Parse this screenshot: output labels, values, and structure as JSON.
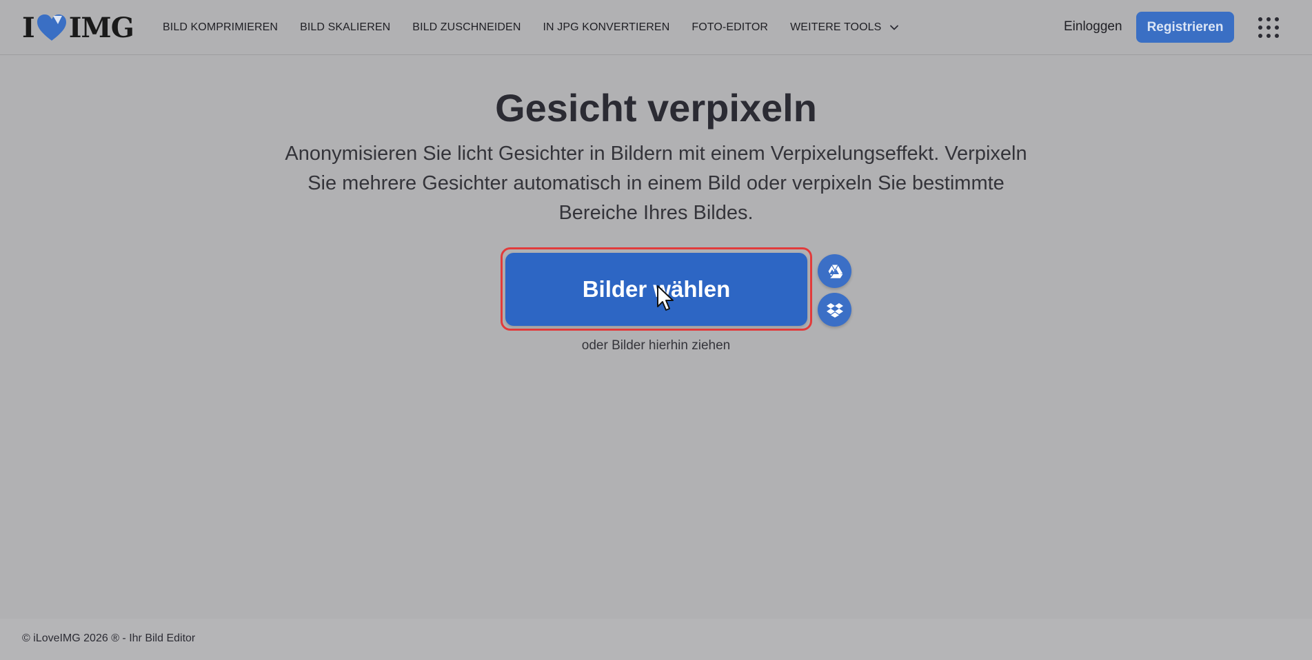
{
  "header": {
    "logo": {
      "left": "I",
      "right": "IMG",
      "heart_color": "#3a6fc4"
    },
    "nav": [
      {
        "label": "BILD KOMPRIMIEREN"
      },
      {
        "label": "BILD SKALIEREN"
      },
      {
        "label": "BILD ZUSCHNEIDEN"
      },
      {
        "label": "IN JPG KONVERTIEREN"
      },
      {
        "label": "FOTO-EDITOR"
      },
      {
        "label": "WEITERE TOOLS",
        "icon": "chevron-down-icon"
      }
    ],
    "login_label": "Einloggen",
    "register_label": "Registrieren",
    "apps_icon": "grid-menu-icon"
  },
  "main": {
    "title": "Gesicht verpixeln",
    "subtitle": "Anonymisieren Sie licht Gesichter in Bildern mit einem Verpixelungseffekt. Verpixeln Sie mehrere Gesichter automatisch in einem Bild oder verpixeln Sie bestimmte Bereiche Ihres Bildes.",
    "select_button_label": "Bilder wählen",
    "cloud_buttons": [
      {
        "icon": "google-drive-icon"
      },
      {
        "icon": "dropbox-icon"
      }
    ],
    "drop_hint": "oder Bilder hierhin ziehen"
  },
  "footer": {
    "text": "© iLoveIMG 2026 ® - Ihr Bild Editor"
  },
  "colors": {
    "accent": "#2d66c4",
    "highlight": "#e23b3b",
    "overlay_background": "#b1b1b3"
  }
}
